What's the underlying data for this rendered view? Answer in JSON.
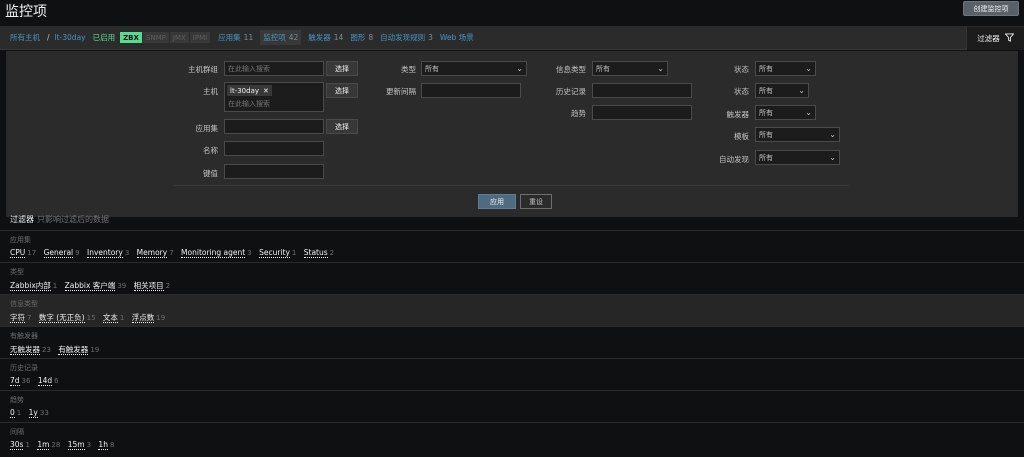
{
  "header": {
    "title": "监控项",
    "create_label": "创建监控项"
  },
  "nav": {
    "all_hosts": "所有主机",
    "separator": "/",
    "host": "lt-30day",
    "enabled": "已启用",
    "tags": [
      "ZBX",
      "SNMP",
      "JMX",
      "IPMI"
    ],
    "links": [
      {
        "label": "应用集",
        "count": "11"
      },
      {
        "label": "监控项",
        "count": "42"
      },
      {
        "label": "触发器",
        "count": "14"
      },
      {
        "label": "图形",
        "count": "8"
      },
      {
        "label": "自动发现规则",
        "count": "3"
      },
      {
        "label": "Web 场景",
        "count": ""
      }
    ],
    "filter_tab": "过滤器",
    "filter_icon": "funnel-icon"
  },
  "filter": {
    "host_group_label": "主机群组",
    "host_group_placeholder": "在此输入搜索",
    "host_label": "主机",
    "host_chip": "lt-30day",
    "host_placeholder": "在此输入搜索",
    "app_label": "应用集",
    "name_label": "名称",
    "key_label": "键值",
    "select_btn": "选择",
    "type_label": "类型",
    "type_value": "所有",
    "interval_label": "更新间隔",
    "info_type_label": "信息类型",
    "info_type_value": "所有",
    "history_label": "历史记录",
    "trends_label": "趋势",
    "state_label": "状态",
    "state_value": "所有",
    "status_label": "状态",
    "status_value": "所有",
    "triggers_label": "触发器",
    "triggers_value": "所有",
    "template_label": "模板",
    "template_value": "所有",
    "discovery_label": "自动发现",
    "discovery_value": "所有",
    "apply": "应用",
    "reset": "重设"
  },
  "subfilter": {
    "title": "过滤器",
    "note": "只影响过滤后的数据",
    "groups": [
      {
        "title": "应用集",
        "items": [
          {
            "label": "CPU",
            "count": "17"
          },
          {
            "label": "General",
            "count": "9"
          },
          {
            "label": "Inventory",
            "count": "3"
          },
          {
            "label": "Memory",
            "count": "7"
          },
          {
            "label": "Monitoring agent",
            "count": "3"
          },
          {
            "label": "Security",
            "count": "1"
          },
          {
            "label": "Status",
            "count": "2"
          }
        ]
      },
      {
        "title": "类型",
        "items": [
          {
            "label": "Zabbix内部",
            "count": "1"
          },
          {
            "label": "Zabbix 客户端",
            "count": "39"
          },
          {
            "label": "相关项目",
            "count": "2"
          }
        ]
      },
      {
        "title": "信息类型",
        "items": [
          {
            "label": "字符",
            "count": "7"
          },
          {
            "label": "数字 (无正负)",
            "count": "15"
          },
          {
            "label": "文本",
            "count": "1"
          },
          {
            "label": "浮点数",
            "count": "19"
          }
        ]
      },
      {
        "title": "有触发器",
        "items": [
          {
            "label": "无触发器",
            "count": "23"
          },
          {
            "label": "有触发器",
            "count": "19"
          }
        ]
      },
      {
        "title": "历史记录",
        "items": [
          {
            "label": "7d",
            "count": "36"
          },
          {
            "label": "14d",
            "count": "6"
          }
        ]
      },
      {
        "title": "趋势",
        "items": [
          {
            "label": "0",
            "count": "1"
          },
          {
            "label": "1y",
            "count": "33"
          }
        ]
      },
      {
        "title": "间隔",
        "items": [
          {
            "label": "30s",
            "count": "1"
          },
          {
            "label": "1m",
            "count": "28"
          },
          {
            "label": "15m",
            "count": "3"
          },
          {
            "label": "1h",
            "count": "8"
          }
        ]
      }
    ]
  }
}
